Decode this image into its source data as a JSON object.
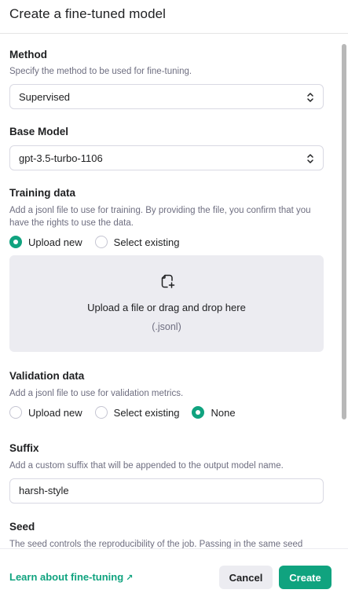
{
  "header": {
    "title": "Create a fine-tuned model"
  },
  "method": {
    "label": "Method",
    "description": "Specify the method to be used for fine-tuning.",
    "selected": "Supervised"
  },
  "base_model": {
    "label": "Base Model",
    "selected": "gpt-3.5-turbo-1106"
  },
  "training_data": {
    "label": "Training data",
    "description": "Add a jsonl file to use for training. By providing the file, you confirm that you have the rights to use the data.",
    "options": [
      "Upload new",
      "Select existing"
    ],
    "selected": "Upload new",
    "dropzone": {
      "icon": "upload-file-icon",
      "text": "Upload a file or drag and drop here",
      "hint": "(.jsonl)"
    }
  },
  "validation_data": {
    "label": "Validation data",
    "description": "Add a jsonl file to use for validation metrics.",
    "options": [
      "Upload new",
      "Select existing",
      "None"
    ],
    "selected": "None"
  },
  "suffix": {
    "label": "Suffix",
    "description": "Add a custom suffix that will be appended to the output model name.",
    "value": "harsh-style"
  },
  "seed": {
    "label": "Seed",
    "description": "The seed controls the reproducibility of the job. Passing in the same seed"
  },
  "footer": {
    "learn_link": "Learn about fine-tuning",
    "learn_link_icon": "external-arrow-icon",
    "cancel_label": "Cancel",
    "create_label": "Create"
  },
  "colors": {
    "accent": "#10a37f",
    "muted_text": "#6e6e80",
    "dropzone_bg": "#ececf1"
  }
}
